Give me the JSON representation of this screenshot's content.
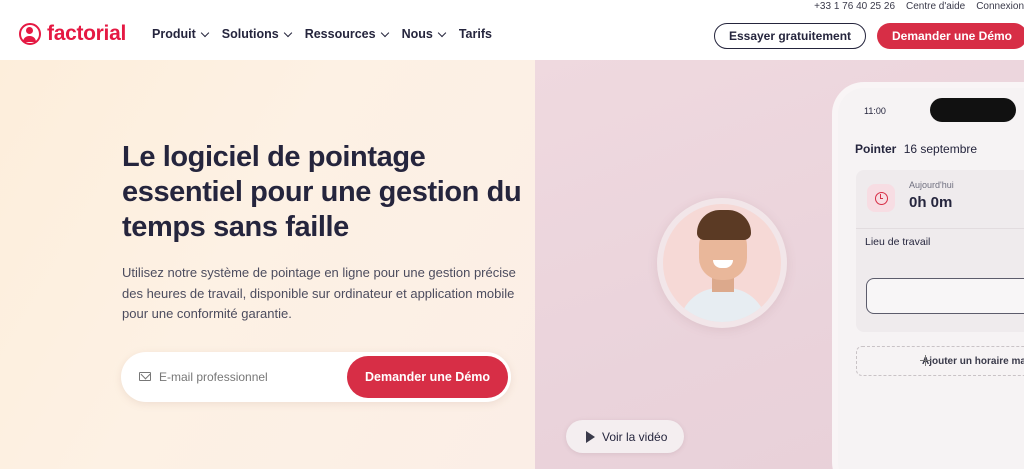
{
  "topbar": {
    "phone": "+33 1 76 40 25 26",
    "help": "Centre d'aide",
    "login": "Connexion"
  },
  "header": {
    "logo_text": "factorial",
    "nav": [
      {
        "label": "Produit",
        "has_dropdown": true
      },
      {
        "label": "Solutions",
        "has_dropdown": true
      },
      {
        "label": "Ressources",
        "has_dropdown": true
      },
      {
        "label": "Nous",
        "has_dropdown": true
      },
      {
        "label": "Tarifs",
        "has_dropdown": false
      }
    ],
    "try_free_label": "Essayer gratuitement",
    "demo_label": "Demander une Démo"
  },
  "hero": {
    "headline": "Le logiciel de pointage essentiel pour une gestion du temps sans faille",
    "subtext": "Utilisez notre système de pointage en ligne pour une gestion précise des heures de travail, disponible sur ordinateur et application mobile pour une conformité garantie.",
    "email_placeholder": "E-mail professionnel",
    "email_value": "",
    "cta_label": "Demander une Démo",
    "video_label": "Voir la vidéo"
  },
  "phone_mock": {
    "time": "11:00",
    "title_bold": "Pointer",
    "title_date": "16 septembre",
    "today_label": "Aujourd'hui",
    "hours": "0h 0m",
    "place_label": "Lieu de travail",
    "add_schedule": "Ajouter un horaire ma"
  },
  "colors": {
    "brand": "#e51943",
    "cta": "#d72e46",
    "text": "#25253d",
    "hero_left_bg": "#fdeedb",
    "hero_right_bg": "#ecd6dc"
  }
}
